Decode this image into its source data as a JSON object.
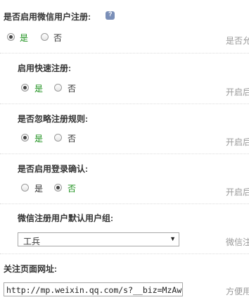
{
  "settings": [
    {
      "label": "是否启用微信用户注册:",
      "options": [
        "是",
        "否"
      ],
      "selected": 0,
      "hint": "是否允",
      "has_help_icon": true
    },
    {
      "label": "启用快速注册:",
      "options": [
        "是",
        "否"
      ],
      "selected": 0,
      "hint": "开启后"
    },
    {
      "label": "是否忽略注册规则:",
      "options": [
        "是",
        "否"
      ],
      "selected": 0,
      "hint": "开启后"
    },
    {
      "label": "是否启用登录确认:",
      "options": [
        "是",
        "否"
      ],
      "selected": 1,
      "hint": "开启后"
    }
  ],
  "default_group": {
    "label": "微信注册用户默认用户组:",
    "value": "工兵",
    "hint": "微信注"
  },
  "follow_url": {
    "label": "关注页面网址:",
    "value": "http://mp.weixin.qq.com/s?__biz=MzAw",
    "hint": "方便用"
  },
  "colors": {
    "selected_option": "#1a8f1a",
    "hint": "#999999",
    "help_icon": "#7a8fb8"
  },
  "icons": {
    "help": "help-icon",
    "dropdown": "dropdown-arrow-icon"
  }
}
